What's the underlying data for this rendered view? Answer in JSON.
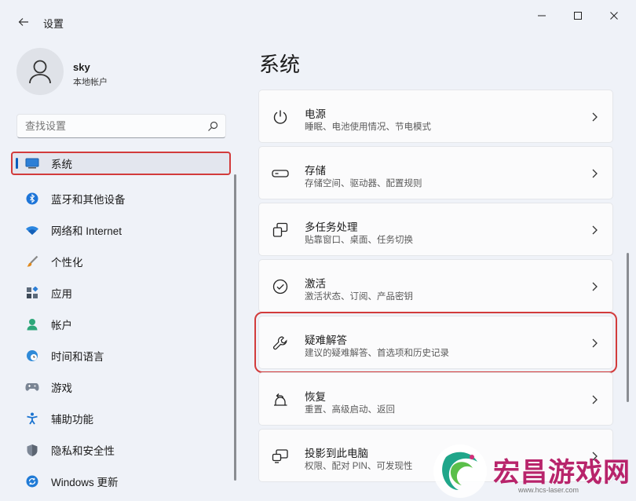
{
  "window": {
    "title": "设置",
    "controls": [
      "minimize",
      "maximize",
      "close"
    ]
  },
  "profile": {
    "name": "sky",
    "account_type": "本地帐户"
  },
  "search": {
    "placeholder": "查找设置"
  },
  "sidebar": {
    "items": [
      {
        "label": "系统",
        "icon": "system-icon",
        "active": true
      },
      {
        "label": "蓝牙和其他设备",
        "icon": "bluetooth-icon"
      },
      {
        "label": "网络和 Internet",
        "icon": "wifi-icon"
      },
      {
        "label": "个性化",
        "icon": "brush-icon"
      },
      {
        "label": "应用",
        "icon": "apps-icon"
      },
      {
        "label": "帐户",
        "icon": "account-icon"
      },
      {
        "label": "时间和语言",
        "icon": "globe-clock-icon"
      },
      {
        "label": "游戏",
        "icon": "gamepad-icon"
      },
      {
        "label": "辅助功能",
        "icon": "accessibility-icon"
      },
      {
        "label": "隐私和安全性",
        "icon": "shield-icon"
      },
      {
        "label": "Windows 更新",
        "icon": "update-icon"
      }
    ]
  },
  "main": {
    "title": "系统",
    "cards": [
      {
        "title": "电源",
        "subtitle": "睡眠、电池使用情况、节电模式",
        "icon": "power-icon"
      },
      {
        "title": "存储",
        "subtitle": "存储空间、驱动器、配置规则",
        "icon": "storage-icon"
      },
      {
        "title": "多任务处理",
        "subtitle": "贴靠窗口、桌面、任务切换",
        "icon": "multitask-icon"
      },
      {
        "title": "激活",
        "subtitle": "激活状态、订阅、产品密钥",
        "icon": "activation-icon"
      },
      {
        "title": "疑难解答",
        "subtitle": "建议的疑难解答、首选项和历史记录",
        "icon": "wrench-icon",
        "highlighted": true
      },
      {
        "title": "恢复",
        "subtitle": "重置、高级启动、返回",
        "icon": "recovery-icon"
      },
      {
        "title": "投影到此电脑",
        "subtitle": "权限、配对 PIN、可发现性",
        "icon": "projection-icon"
      }
    ]
  },
  "watermark": {
    "text": "宏昌游戏网",
    "url": "www.hcs-laser.com"
  },
  "colors": {
    "accent": "#0a5dbc",
    "highlight_box": "#d23b3b",
    "watermark": "#b8246b"
  }
}
